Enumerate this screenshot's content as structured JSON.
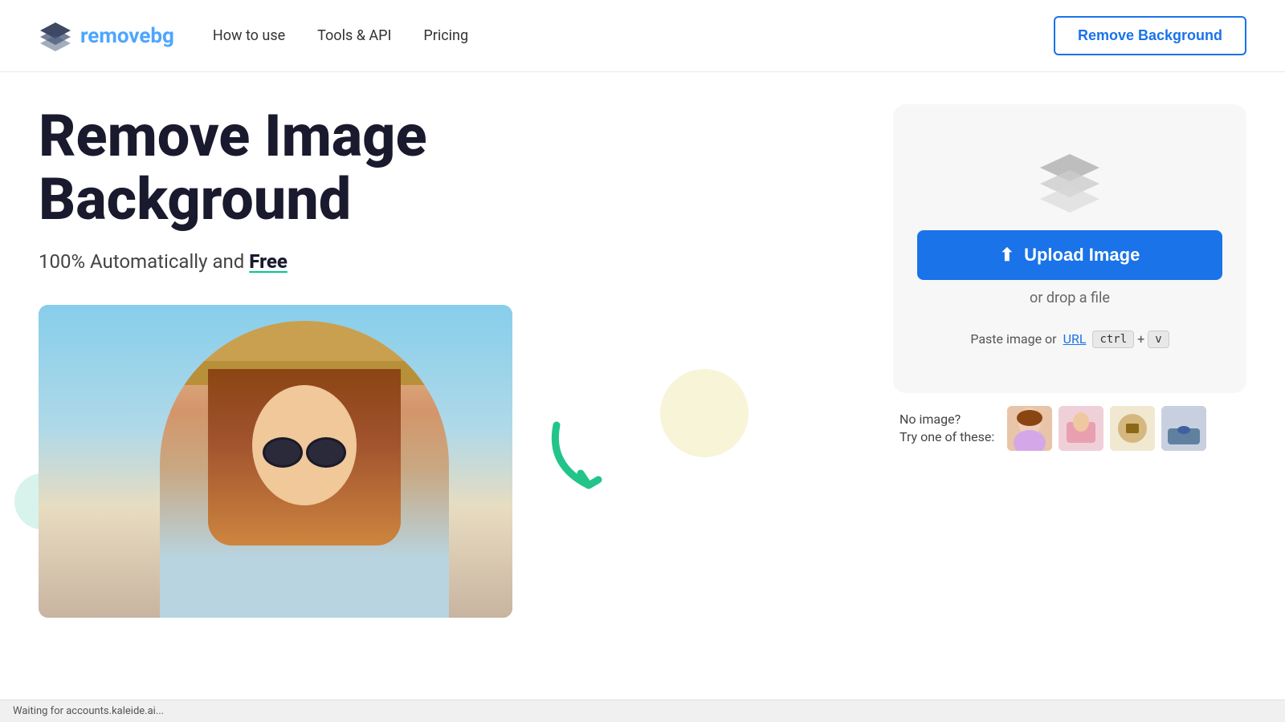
{
  "nav": {
    "logo_text_part1": "remove",
    "logo_text_part2": "bg",
    "links": [
      {
        "id": "how-to-use",
        "label": "How to use"
      },
      {
        "id": "tools-api",
        "label": "Tools & API"
      },
      {
        "id": "pricing",
        "label": "Pricing"
      }
    ],
    "cta_label": "Remove Background"
  },
  "hero": {
    "title_line1": "Remove Image",
    "title_line2": "Background",
    "subtitle_prefix": "100% Automatically and ",
    "subtitle_bold": "Free",
    "upload_card": {
      "upload_button_label": "Upload Image",
      "drop_text": "or drop a file",
      "paste_label": "Paste image or",
      "paste_link_label": "URL",
      "kbd_modifier": "ctrl",
      "kbd_plus": "+",
      "kbd_key": "v",
      "no_image_line1": "No image?",
      "no_image_line2": "Try one of these:"
    }
  },
  "status_bar": {
    "text": "Waiting for accounts.kaleide.ai..."
  },
  "icons": {
    "upload_icon": "⬆",
    "layers_icon": "layers"
  }
}
